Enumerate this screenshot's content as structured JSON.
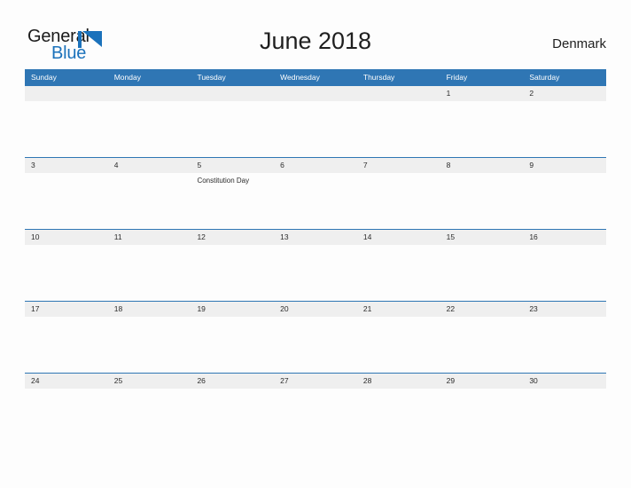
{
  "brand": {
    "name_part1": "General",
    "name_part2": "Blue",
    "color_dark": "#1a1a1a",
    "color_blue": "#1b72bb"
  },
  "header": {
    "title": "June 2018",
    "country": "Denmark",
    "accent_color": "#2f76b4",
    "band_color": "#efefef"
  },
  "weekdays": [
    "Sunday",
    "Monday",
    "Tuesday",
    "Wednesday",
    "Thursday",
    "Friday",
    "Saturday"
  ],
  "weeks": [
    {
      "days": [
        {
          "num": "",
          "events": []
        },
        {
          "num": "",
          "events": []
        },
        {
          "num": "",
          "events": []
        },
        {
          "num": "",
          "events": []
        },
        {
          "num": "",
          "events": []
        },
        {
          "num": "1",
          "events": []
        },
        {
          "num": "2",
          "events": []
        }
      ]
    },
    {
      "days": [
        {
          "num": "3",
          "events": []
        },
        {
          "num": "4",
          "events": []
        },
        {
          "num": "5",
          "events": [
            "Constitution Day"
          ]
        },
        {
          "num": "6",
          "events": []
        },
        {
          "num": "7",
          "events": []
        },
        {
          "num": "8",
          "events": []
        },
        {
          "num": "9",
          "events": []
        }
      ]
    },
    {
      "days": [
        {
          "num": "10",
          "events": []
        },
        {
          "num": "11",
          "events": []
        },
        {
          "num": "12",
          "events": []
        },
        {
          "num": "13",
          "events": []
        },
        {
          "num": "14",
          "events": []
        },
        {
          "num": "15",
          "events": []
        },
        {
          "num": "16",
          "events": []
        }
      ]
    },
    {
      "days": [
        {
          "num": "17",
          "events": []
        },
        {
          "num": "18",
          "events": []
        },
        {
          "num": "19",
          "events": []
        },
        {
          "num": "20",
          "events": []
        },
        {
          "num": "21",
          "events": []
        },
        {
          "num": "22",
          "events": []
        },
        {
          "num": "23",
          "events": []
        }
      ]
    },
    {
      "days": [
        {
          "num": "24",
          "events": []
        },
        {
          "num": "25",
          "events": []
        },
        {
          "num": "26",
          "events": []
        },
        {
          "num": "27",
          "events": []
        },
        {
          "num": "28",
          "events": []
        },
        {
          "num": "29",
          "events": []
        },
        {
          "num": "30",
          "events": []
        }
      ]
    }
  ]
}
